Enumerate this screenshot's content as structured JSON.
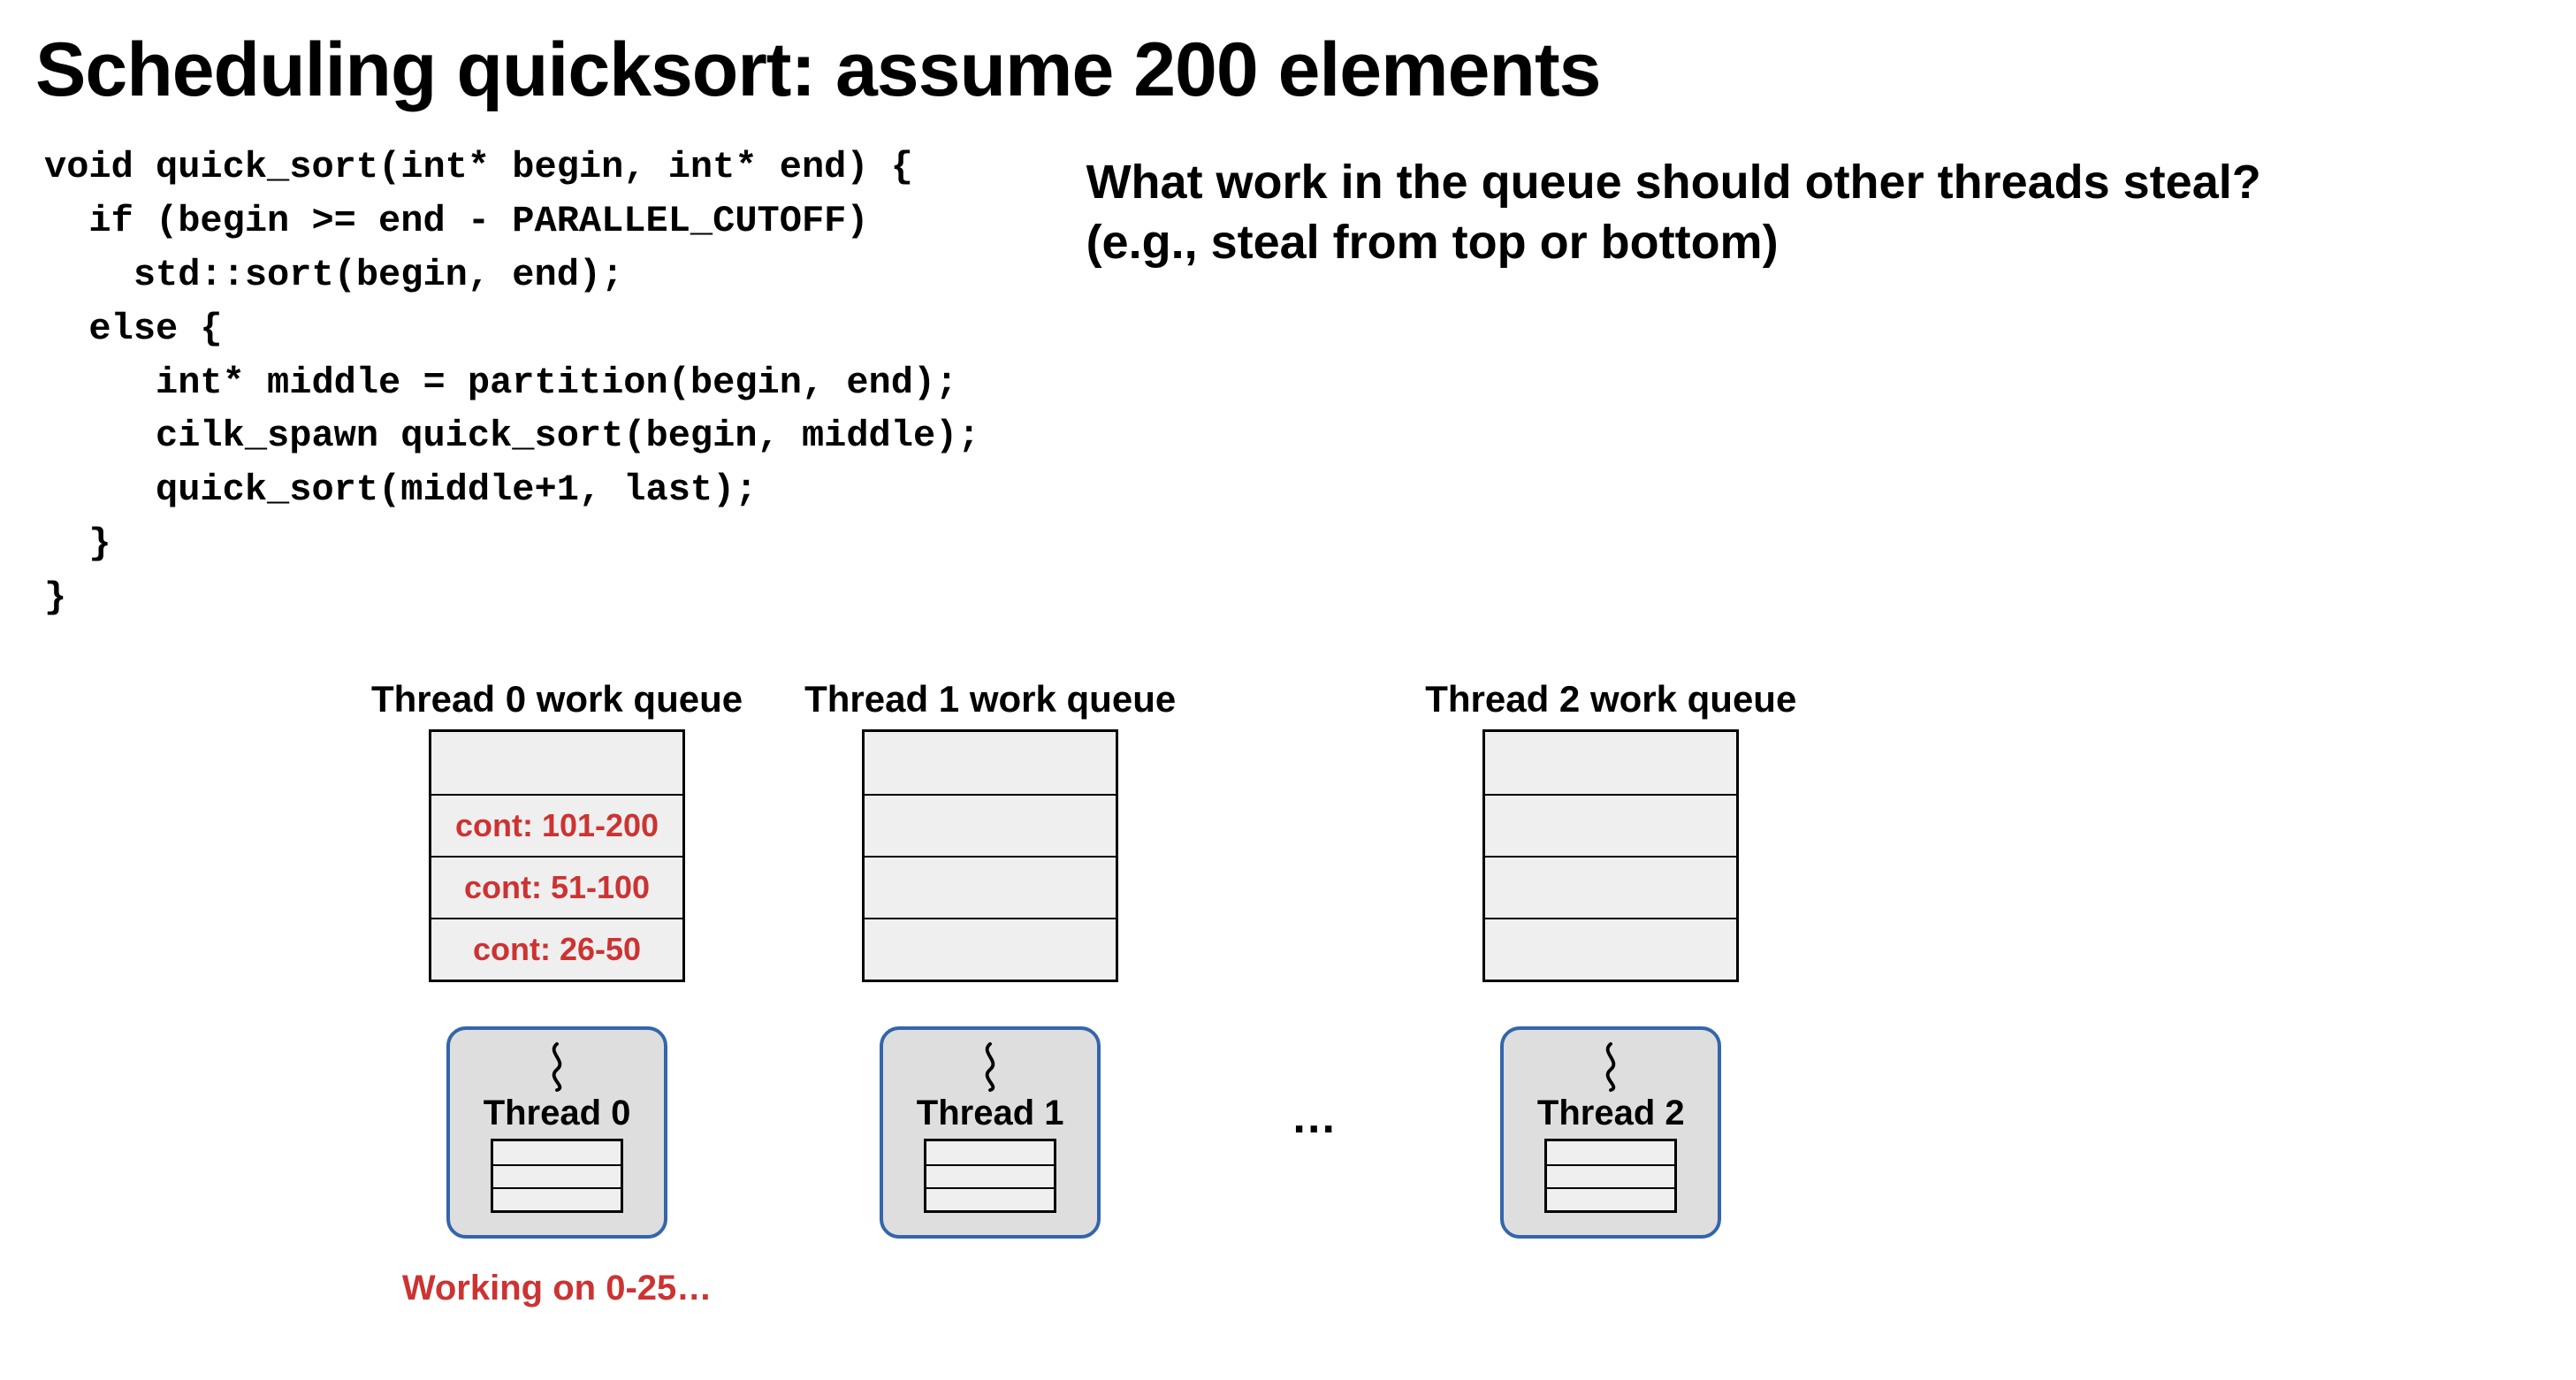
{
  "title": "Scheduling quicksort: assume 200 elements",
  "code": "void quick_sort(int* begin, int* end) {\n  if (begin >= end - PARALLEL_CUTOFF)\n    std::sort(begin, end);\n  else {\n     int* middle = partition(begin, end);\n     cilk_spawn quick_sort(begin, middle);\n     quick_sort(middle+1, last);\n  }\n}",
  "question_line1": "What work in the queue should other threads steal?",
  "question_line2": "(e.g., steal from top or bottom)",
  "ellipsis": "…",
  "queues": [
    {
      "label": "Thread 0 work queue",
      "cells": [
        "",
        "cont: 101-200",
        "cont: 51-100",
        "cont: 26-50"
      ],
      "thread_name": "Thread 0",
      "status": "Working on 0-25…"
    },
    {
      "label": "Thread 1 work queue",
      "cells": [
        "",
        "",
        "",
        ""
      ],
      "thread_name": "Thread 1",
      "status": ""
    },
    {
      "label": "Thread 2 work queue",
      "cells": [
        "",
        "",
        "",
        ""
      ],
      "thread_name": "Thread 2",
      "status": ""
    }
  ]
}
